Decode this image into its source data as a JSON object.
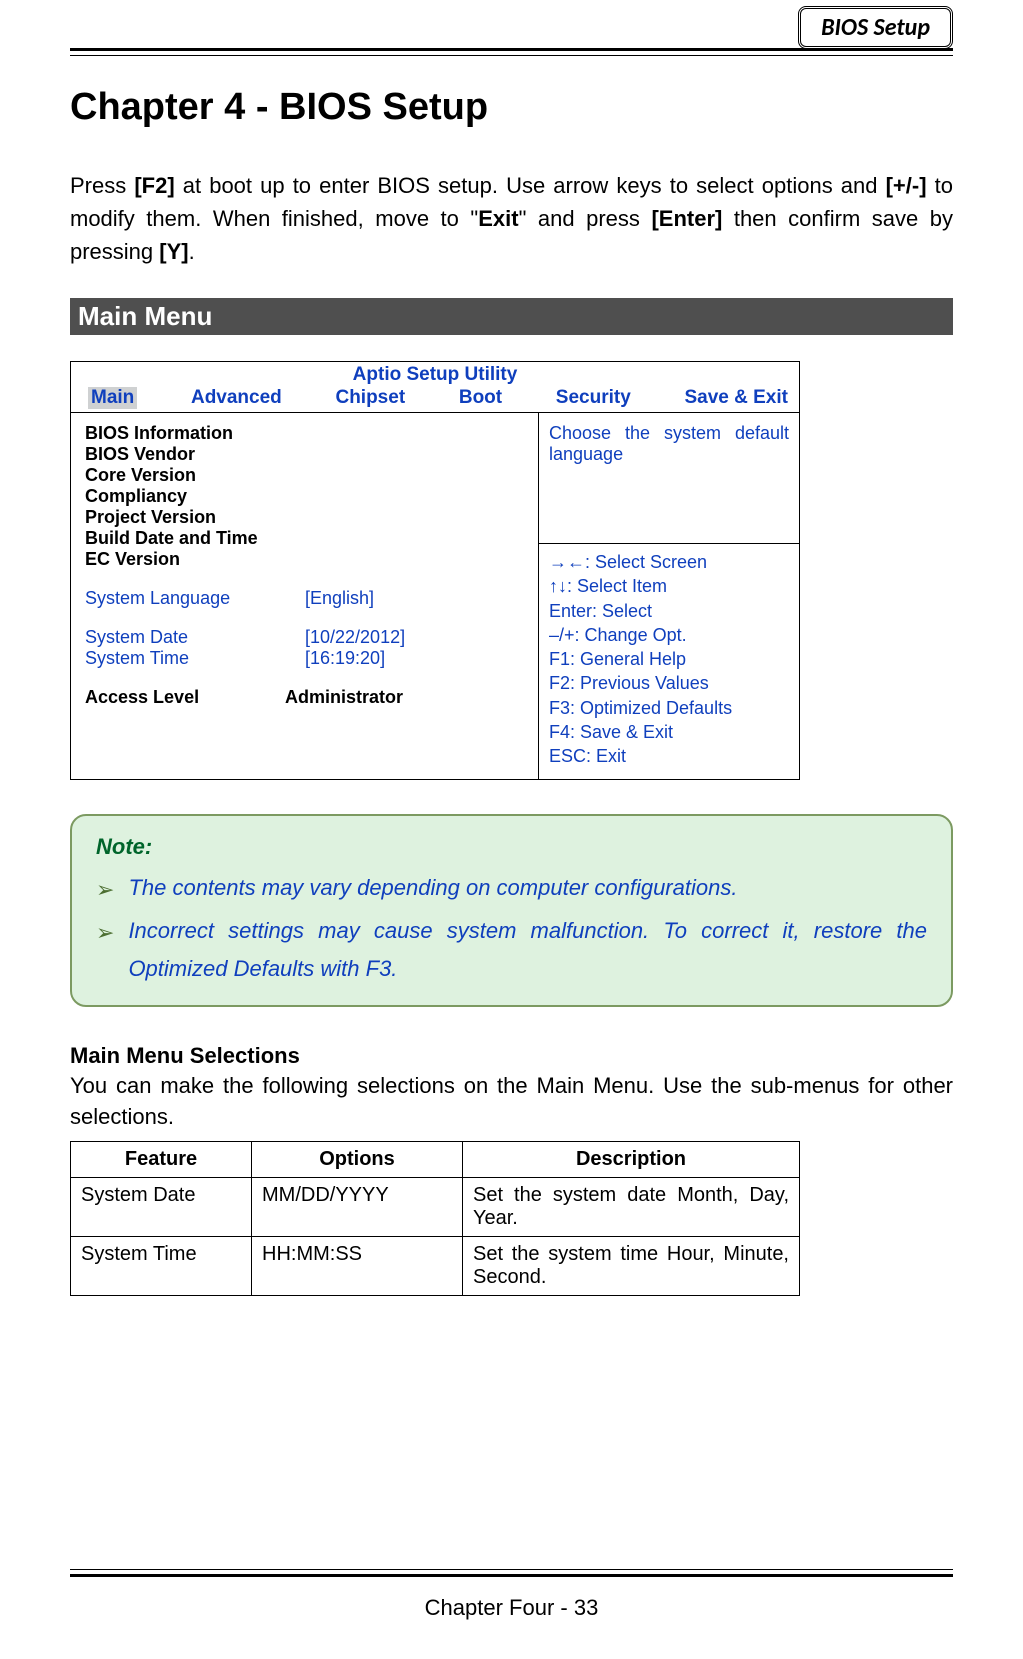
{
  "header": {
    "badge": "BIOS Setup"
  },
  "title": "Chapter 4 - BIOS Setup",
  "intro": {
    "t1": "Press ",
    "k1": "[F2]",
    "t2": " at boot up to enter BIOS setup. Use arrow keys to select options and ",
    "k2": "[+/-]",
    "t3": " to modify them. When finished, move to \"",
    "k3": "Exit",
    "t4": "\" and press ",
    "k4": "[Enter]",
    "t5": " then confirm save by pressing ",
    "k5": "[Y]",
    "t6": "."
  },
  "section": {
    "main_menu": "Main Menu"
  },
  "bios": {
    "utility_title": "Aptio Setup Utility",
    "tabs": {
      "main": "Main",
      "advanced": "Advanced",
      "chipset": "Chipset",
      "boot": "Boot",
      "security": "Security",
      "saveexit": "Save & Exit"
    },
    "left": {
      "info_header": "BIOS Information",
      "vendor": "BIOS Vendor",
      "core": "Core Version",
      "compliancy": "Compliancy",
      "project": "Project Version",
      "build": "Build Date and Time",
      "ec": "EC Version",
      "lang_label": "System Language",
      "lang_value": "[English]",
      "date_label": "System Date",
      "date_value": "[10/22/2012]",
      "time_label": "System Time",
      "time_value": "[16:19:20]",
      "access_label": "Access Level",
      "access_value": "Administrator"
    },
    "help": "Choose the system default language",
    "keys": {
      "a": "→←: Select Screen",
      "b": "↑↓: Select Item",
      "c": "Enter: Select",
      "d": "–/+: Change Opt.",
      "e": "F1: General Help",
      "f": "F2: Previous Values",
      "g": "F3: Optimized Defaults",
      "h": "F4: Save & Exit",
      "i": "ESC: Exit"
    }
  },
  "note": {
    "label": "Note:",
    "bullet1": "The contents may vary depending on computer configurations.",
    "bullet2": "Incorrect settings may cause system malfunction. To correct it, restore the Optimized Defaults with F3."
  },
  "selections": {
    "heading": "Main Menu Selections",
    "lead": "You can make the following selections on the Main Menu. Use the sub-menus for other selections.",
    "cols": {
      "feature": "Feature",
      "options": "Options",
      "description": "Description"
    },
    "rows": [
      {
        "feature": "System Date",
        "options": "MM/DD/YYYY",
        "description": "Set the system date Month, Day, Year."
      },
      {
        "feature": "System Time",
        "options": "HH:MM:SS",
        "description": "Set the system time Hour, Minute, Second."
      }
    ]
  },
  "footer": "Chapter Four - 33"
}
